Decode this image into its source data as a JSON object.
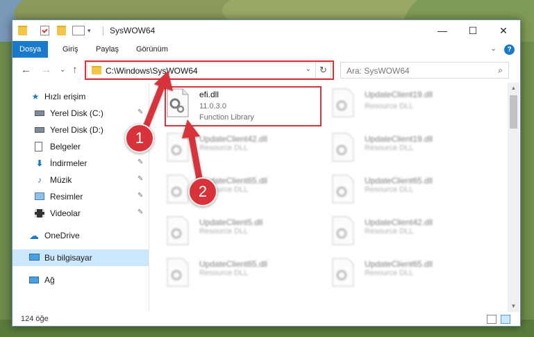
{
  "window": {
    "title": "SysWOW64",
    "minimize_glyph": "—",
    "maximize_glyph": "☐",
    "close_glyph": "✕"
  },
  "ribbon": {
    "tabs": [
      {
        "label": "Dosya",
        "active": true
      },
      {
        "label": "Giriş",
        "active": false
      },
      {
        "label": "Paylaş",
        "active": false
      },
      {
        "label": "Görünüm",
        "active": false
      }
    ],
    "expand_glyph": "⌄",
    "help_glyph": "?"
  },
  "nav": {
    "back_glyph": "←",
    "forward_glyph": "→",
    "recent_glyph": "⌄",
    "up_glyph": "↑"
  },
  "address": {
    "path": "C:\\Windows\\SysWOW64",
    "dropdown_glyph": "⌄",
    "refresh_glyph": "↻"
  },
  "search": {
    "placeholder": "Ara: SysWOW64",
    "icon_glyph": "⌕"
  },
  "sidebar": {
    "items": [
      {
        "label": "Hızlı erişim",
        "icon": "star-icon",
        "pinned": false
      },
      {
        "label": "Yerel Disk (C:)",
        "icon": "drive-icon",
        "pinned": true
      },
      {
        "label": "Yerel Disk (D:)",
        "icon": "drive-icon",
        "pinned": true
      },
      {
        "label": "Belgeler",
        "icon": "documents-icon",
        "pinned": true
      },
      {
        "label": "İndirmeler",
        "icon": "download-icon",
        "pinned": true
      },
      {
        "label": "Müzik",
        "icon": "music-icon",
        "pinned": true
      },
      {
        "label": "Resimler",
        "icon": "pictures-icon",
        "pinned": true
      },
      {
        "label": "Videolar",
        "icon": "videos-icon",
        "pinned": true
      },
      {
        "label": "OneDrive",
        "icon": "cloud-icon",
        "pinned": false
      },
      {
        "label": "Bu bilgisayar",
        "icon": "computer-icon",
        "pinned": false,
        "selected": true
      },
      {
        "label": "Ağ",
        "icon": "network-icon",
        "pinned": false
      }
    ],
    "pin_glyph": "📌"
  },
  "files": [
    {
      "name": "efi.dll",
      "line2": "11.0.3.0",
      "line3": "Function Library",
      "highlighted": true
    },
    {
      "name": "UpdateClient19.dll",
      "line2": "Resource DLL"
    },
    {
      "name": "UpdateClient42.dll",
      "line2": "Resource DLL"
    },
    {
      "name": "UpdateClient19.dll",
      "line2": "Resource DLL"
    },
    {
      "name": "UpdateClient65.dll",
      "line2": "Resource DLL"
    },
    {
      "name": "UpdateClient65.dll",
      "line2": "Resource DLL"
    },
    {
      "name": "UpdateClient5.dll",
      "line2": "Resource DLL"
    },
    {
      "name": "UpdateClient42.dll",
      "line2": "Resource DLL"
    },
    {
      "name": "UpdateClient65.dll",
      "line2": "Resource DLL"
    },
    {
      "name": "UpdateClient65.dll",
      "line2": "Resource DLL"
    }
  ],
  "status": {
    "count": "124 öğe"
  },
  "callouts": [
    {
      "number": "1"
    },
    {
      "number": "2"
    }
  ],
  "colors": {
    "accent": "#1979ca",
    "callout_red": "#d8333a",
    "selection": "#cce8ff"
  }
}
